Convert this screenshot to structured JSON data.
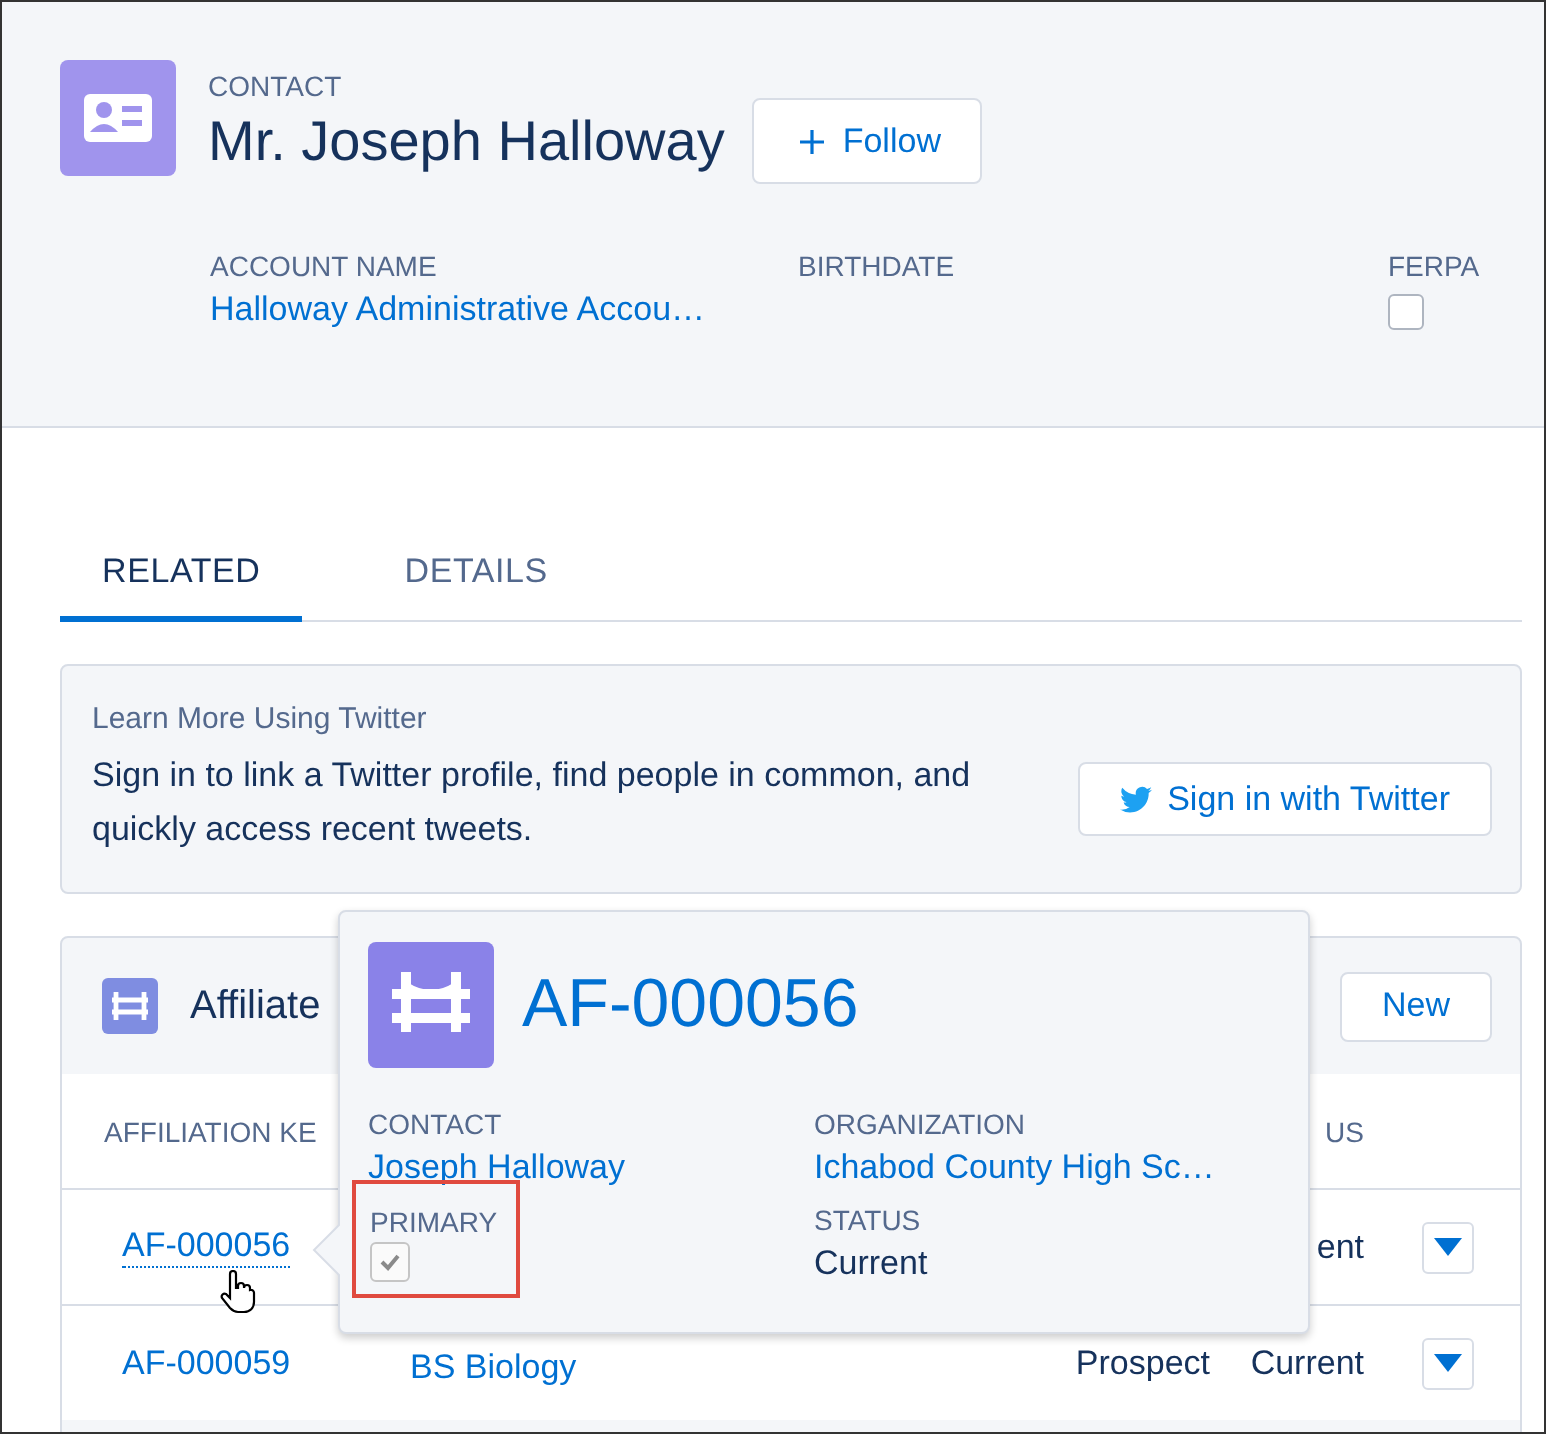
{
  "record": {
    "type_label": "CONTACT",
    "name": "Mr. Joseph Halloway",
    "follow_button": "Follow",
    "fields": [
      {
        "label": "ACCOUNT NAME",
        "kind": "link",
        "value": "Halloway Administrative Accou…"
      },
      {
        "label": "BIRTHDATE",
        "kind": "text"
      },
      {
        "label": "FERPA",
        "kind": "checkbox",
        "checked": false
      }
    ]
  },
  "tabs": [
    {
      "label": "RELATED",
      "selected": true
    },
    {
      "label": "DETAILS",
      "selected": false
    }
  ],
  "twitter": {
    "title": "Learn More Using Twitter",
    "text": "Sign in to link a Twitter profile, find people in common, and quickly access recent tweets.",
    "button": "Sign in with Twitter"
  },
  "affiliations": {
    "title": "Affiliate",
    "button": "New",
    "header": {
      "column_1": "AFFILIATION KE",
      "column_4": "US"
    },
    "rows": [
      {
        "column_1": "AF-000056",
        "column_4": "ent",
        "hovered": true
      },
      {
        "column_1": "AF-000059",
        "column_2": "BS Biology",
        "column_3": "Prospect",
        "column_4": "Current",
        "hovered": false
      }
    ]
  },
  "popover": {
    "title": "AF-000056",
    "fields": [
      {
        "label": "CONTACT",
        "kind": "link",
        "value": "Joseph Halloway"
      },
      {
        "label": "ORGANIZATION",
        "kind": "link",
        "value": "Ichabod County High Sc…"
      },
      {
        "label": "PRIMARY",
        "kind": "checkbox",
        "checked": true,
        "highlighted": true
      },
      {
        "label": "STATUS",
        "kind": "text",
        "value": "Current"
      }
    ]
  }
}
